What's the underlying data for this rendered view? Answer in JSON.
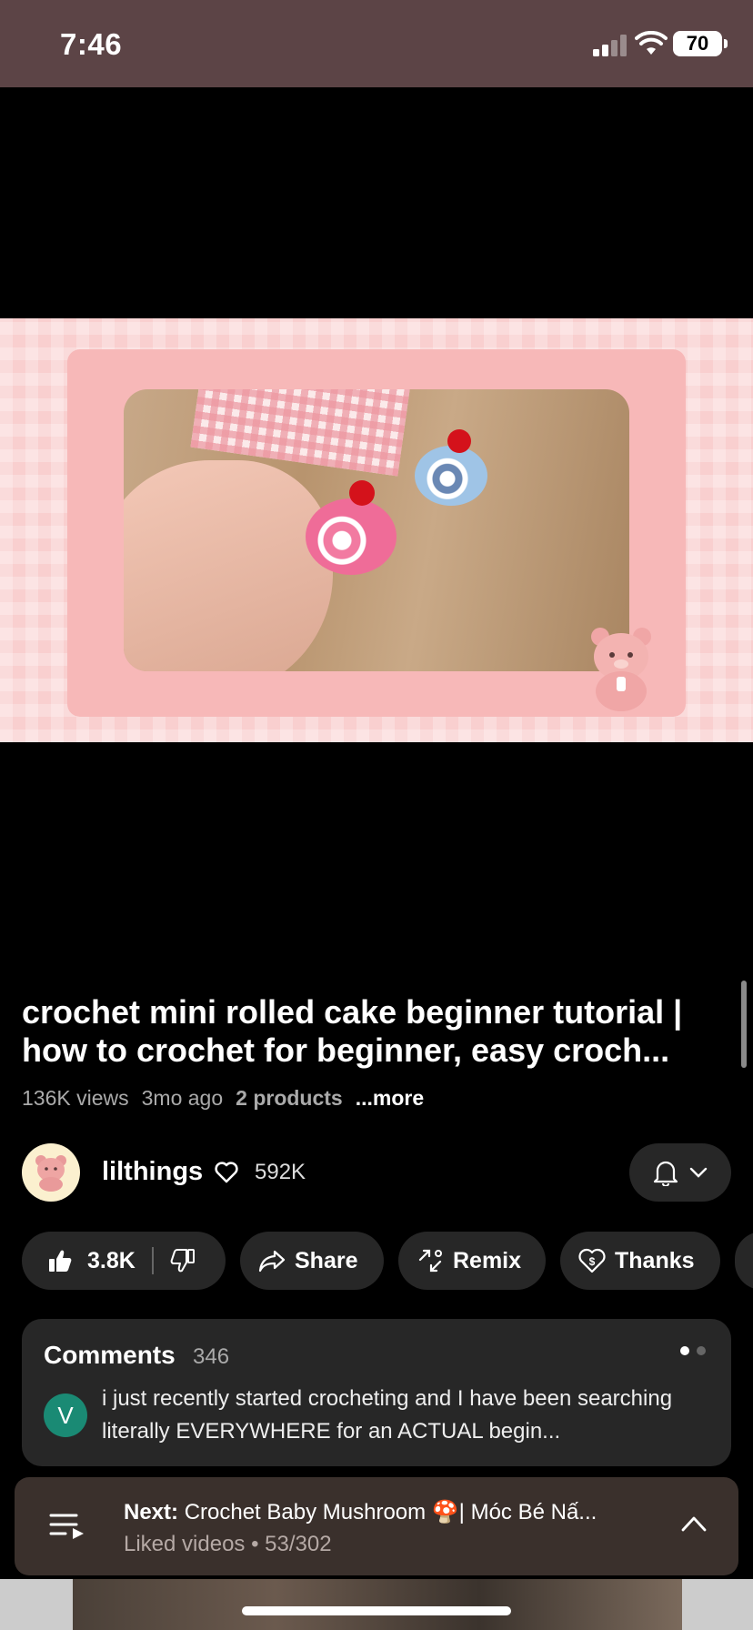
{
  "status_bar": {
    "time": "7:46",
    "battery": "70"
  },
  "video": {
    "title": "crochet mini rolled cake beginner tutorial | how to crochet for beginner, easy croch...",
    "views": "136K views",
    "age": "3mo ago",
    "products": "2 products",
    "more": "...more"
  },
  "channel": {
    "name": "lilthings",
    "subscribers": "592K"
  },
  "actions": {
    "likes": "3.8K",
    "share": "Share",
    "remix": "Remix",
    "thanks": "Thanks"
  },
  "comments": {
    "title": "Comments",
    "count": "346",
    "avatar_letter": "V",
    "top_comment": "i just recently started crocheting and I have been searching literally EVERYWHERE for an ACTUAL begin..."
  },
  "next": {
    "label": "Next:",
    "title": "Crochet Baby Mushroom 🍄| Móc Bé Nấ...",
    "playlist": "Liked videos • 53/302"
  },
  "colors": {
    "accent_avatar": "#1a8a74",
    "status_bar_bg": "#5c4446"
  }
}
